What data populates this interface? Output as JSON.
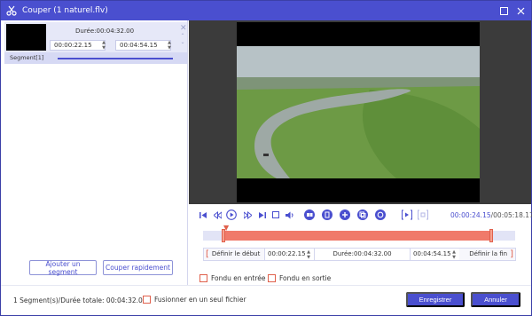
{
  "window": {
    "title": "Couper (1 naturel.flv)",
    "accent": "#4a4fcf",
    "highlight": "#f07a6a"
  },
  "segment": {
    "duration_label": "Durée:00:04:32.00",
    "start": "00:00:22.15",
    "end": "00:04:54.15",
    "label": "Segment[1]"
  },
  "left_buttons": {
    "add": "Ajouter un segment",
    "quick": "Couper rapidement"
  },
  "player": {
    "current": "00:00:24.15",
    "total": "/00:05:18.17"
  },
  "editor": {
    "set_start": "Définir le début",
    "start_time": "00:00:22.15",
    "duration": "Durée:00:04:32.00",
    "end_time": "00:04:54.15",
    "set_end": "Définir la fin"
  },
  "fades": {
    "fade_in": "Fondu en entrée",
    "fade_out": "Fondu en sortie"
  },
  "footer": {
    "status": "1 Segment(s)/Durée totale: 00:04:32.00",
    "merge": "Fusionner en un seul fichier",
    "save": "Enregistrer",
    "cancel": "Annuler"
  }
}
